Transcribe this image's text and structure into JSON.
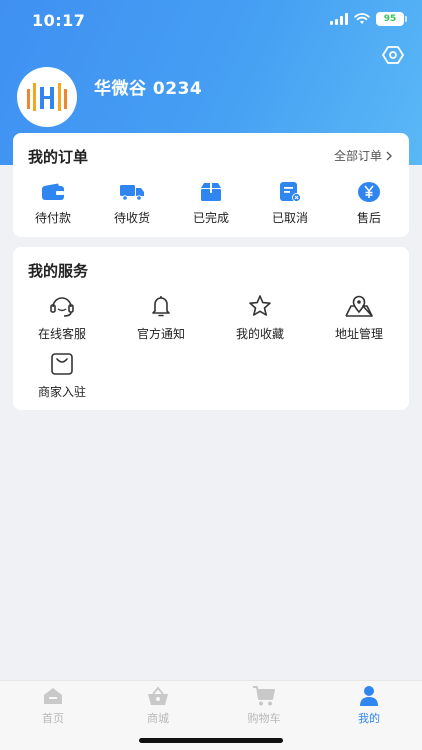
{
  "status_bar": {
    "time": "10:17",
    "battery": "95"
  },
  "profile": {
    "username": "华微谷 0234"
  },
  "orders": {
    "title": "我的订单",
    "all_orders_label": "全部订单",
    "items": [
      {
        "label": "待付款",
        "icon": "wallet-icon"
      },
      {
        "label": "待收货",
        "icon": "truck-icon"
      },
      {
        "label": "已完成",
        "icon": "box-icon"
      },
      {
        "label": "已取消",
        "icon": "cancelled-doc-icon"
      },
      {
        "label": "售后",
        "icon": "yen-icon"
      }
    ]
  },
  "services": {
    "title": "我的服务",
    "items": [
      {
        "label": "在线客服",
        "icon": "headset-icon"
      },
      {
        "label": "官方通知",
        "icon": "bell-icon"
      },
      {
        "label": "我的收藏",
        "icon": "star-icon"
      },
      {
        "label": "地址管理",
        "icon": "location-map-icon"
      },
      {
        "label": "商家入驻",
        "icon": "shopping-bag-icon"
      }
    ]
  },
  "tabbar": {
    "active": "我的",
    "items": [
      {
        "label": "首页",
        "icon": "home-icon"
      },
      {
        "label": "商城",
        "icon": "basket-icon"
      },
      {
        "label": "购物车",
        "icon": "cart-icon"
      },
      {
        "label": "我的",
        "icon": "user-icon"
      }
    ]
  },
  "colors": {
    "accent": "#2f86f0",
    "header": "#46a0f3",
    "inactive": "#b8b8b8"
  }
}
